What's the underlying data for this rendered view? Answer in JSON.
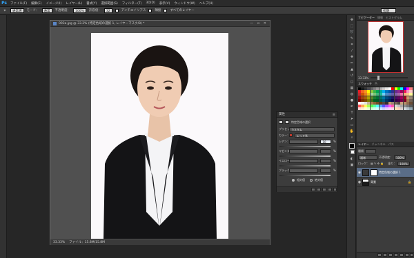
{
  "menubar": {
    "logo": "Ps",
    "items": [
      "ファイル(F)",
      "編集(E)",
      "イメージ(I)",
      "レイヤー(L)",
      "書式(Y)",
      "選択範囲(S)",
      "フィルター(T)",
      "3D(D)",
      "表示(V)",
      "ウィンドウ(W)",
      "ヘルプ(H)"
    ]
  },
  "optbar": {
    "tool_glyph": "⌖",
    "preset_value": "通常選",
    "mode_label": "モード：",
    "mode_value": "通常",
    "opacity_label": "不透明度：",
    "opacity_value": "100%",
    "flow_label": "許容値：",
    "flow_value": "32",
    "antialias_label": "アンチエイリアス",
    "contiguous_label": "隣接",
    "all_layers_label": "すべてのレイヤー",
    "workspace_value": "初期"
  },
  "document": {
    "title": "003a.jpg @ 33.2% (特定色域の選択 1, レイヤーマスク/8) *",
    "window_controls": "— ▫ ✕",
    "zoom": "33.33%",
    "file_info": "ファイル：15.8M/15.8M"
  },
  "properties": {
    "panel_title": "属性",
    "adjustment_title": "特定色域の選択",
    "preset_label": "プリセット：",
    "preset_value": "カスタム",
    "color_label": "カラー：",
    "color_value": "レッド系",
    "cyan_label": "シアン：",
    "cyan_value": "-10",
    "magenta_label": "マゼンタ：",
    "magenta_value": "",
    "yellow_label": "イエロー：",
    "yellow_value": "",
    "black_label": "ブラック：",
    "black_value": "",
    "percent": "%",
    "relative_label": "相対値",
    "absolute_label": "絶対値",
    "red_color": "#c0392b"
  },
  "navigator": {
    "tabs": [
      "ナビゲーター",
      "情報",
      "ヒストグラム"
    ],
    "zoom": "33.33%"
  },
  "swatches": {
    "tabs": [
      "スウォッチ",
      "色"
    ],
    "colors": [
      "#000000",
      "#1a1a1a",
      "#333333",
      "#4d4d4d",
      "#666666",
      "#808080",
      "#999999",
      "#b3b3b3",
      "#cccccc",
      "#e6e6e6",
      "#ffffff",
      "#ff0000",
      "#ffff00",
      "#00ff00",
      "#00ffff",
      "#0000ff",
      "#ff00ff",
      "#ff8080",
      "#ed1c24",
      "#f26522",
      "#f7941d",
      "#fff200",
      "#8dc63f",
      "#39b54a",
      "#00a651",
      "#00a99d",
      "#00aeef",
      "#0072bc",
      "#0054a6",
      "#2e3192",
      "#662d91",
      "#92278f",
      "#9e005d",
      "#ed145b",
      "#f49ac1",
      "#ffc7c7",
      "#c1272d",
      "#d35400",
      "#e67e22",
      "#f1c40f",
      "#a3d39c",
      "#7cc576",
      "#3cb878",
      "#1abc9c",
      "#6dcff6",
      "#448ccb",
      "#5674b9",
      "#605ca8",
      "#8560a8",
      "#a864a8",
      "#f06eaa",
      "#f9ad81",
      "#fdc68a",
      "#fff799",
      "#9e0b0f",
      "#a0410d",
      "#a36209",
      "#aba000",
      "#598527",
      "#197b30",
      "#007236",
      "#00746b",
      "#0076a3",
      "#004a80",
      "#003471",
      "#1b1464",
      "#440e62",
      "#630460",
      "#9e005d",
      "#a0001e",
      "#c69c6d",
      "#998675",
      "#790000",
      "#7b2e00",
      "#7d4900",
      "#827b00",
      "#406618",
      "#005e20",
      "#005826",
      "#005952",
      "#005b7f",
      "#003663",
      "#002157",
      "#0d004c",
      "#32004b",
      "#4b0049",
      "#7b0046",
      "#7a0026",
      "#a67c52",
      "#736357",
      "#ffffff",
      "#f2f2f2",
      "#e0e0e0",
      "#c7b299",
      "#a67c52",
      "#8c6239",
      "#754c24",
      "#603913",
      "#534741",
      "#362f2d",
      "#c69c6d",
      "#998675",
      "#736357",
      "#534741",
      "#c8a27c",
      "#b58d67",
      "#8f6a4c",
      "#6b4c35",
      "#ff5555",
      "#ffaa55",
      "#ffff55",
      "#aaff55",
      "#55ff55",
      "#55ffaa",
      "#55ffff",
      "#55aaff",
      "#5555ff",
      "#aa55ff",
      "#ff55ff",
      "#ff55aa",
      "#d9d9d9",
      "#bfbfbf",
      "#a6a6a6",
      "#8c8c8c",
      "#737373",
      "#595959",
      "#ffd6d6",
      "#ffe8cc",
      "#ffffcc",
      "#e8ffcc",
      "#ccffcc",
      "#ccffe8",
      "#ccffff",
      "#cce8ff",
      "#ccccff",
      "#e8ccff",
      "#ffccff",
      "#ffcce8",
      "#ffe0b2",
      "#ffccbc",
      "#d7ccc8",
      "#cfd8dc",
      "#b0bec5",
      "#90a4ae"
    ]
  },
  "layers": {
    "tabs": [
      "レイヤー",
      "チャンネル",
      "パス"
    ],
    "kind_label": "種類",
    "blend_value": "通常",
    "opacity_label": "不透明度：",
    "opacity_value": "100%",
    "lock_label": "ロック：",
    "fill_label": "塗り：",
    "fill_value": "100%",
    "rows": [
      {
        "name": "特定色域の選択 1",
        "selected": true
      },
      {
        "name": "背景",
        "selected": false
      }
    ]
  }
}
